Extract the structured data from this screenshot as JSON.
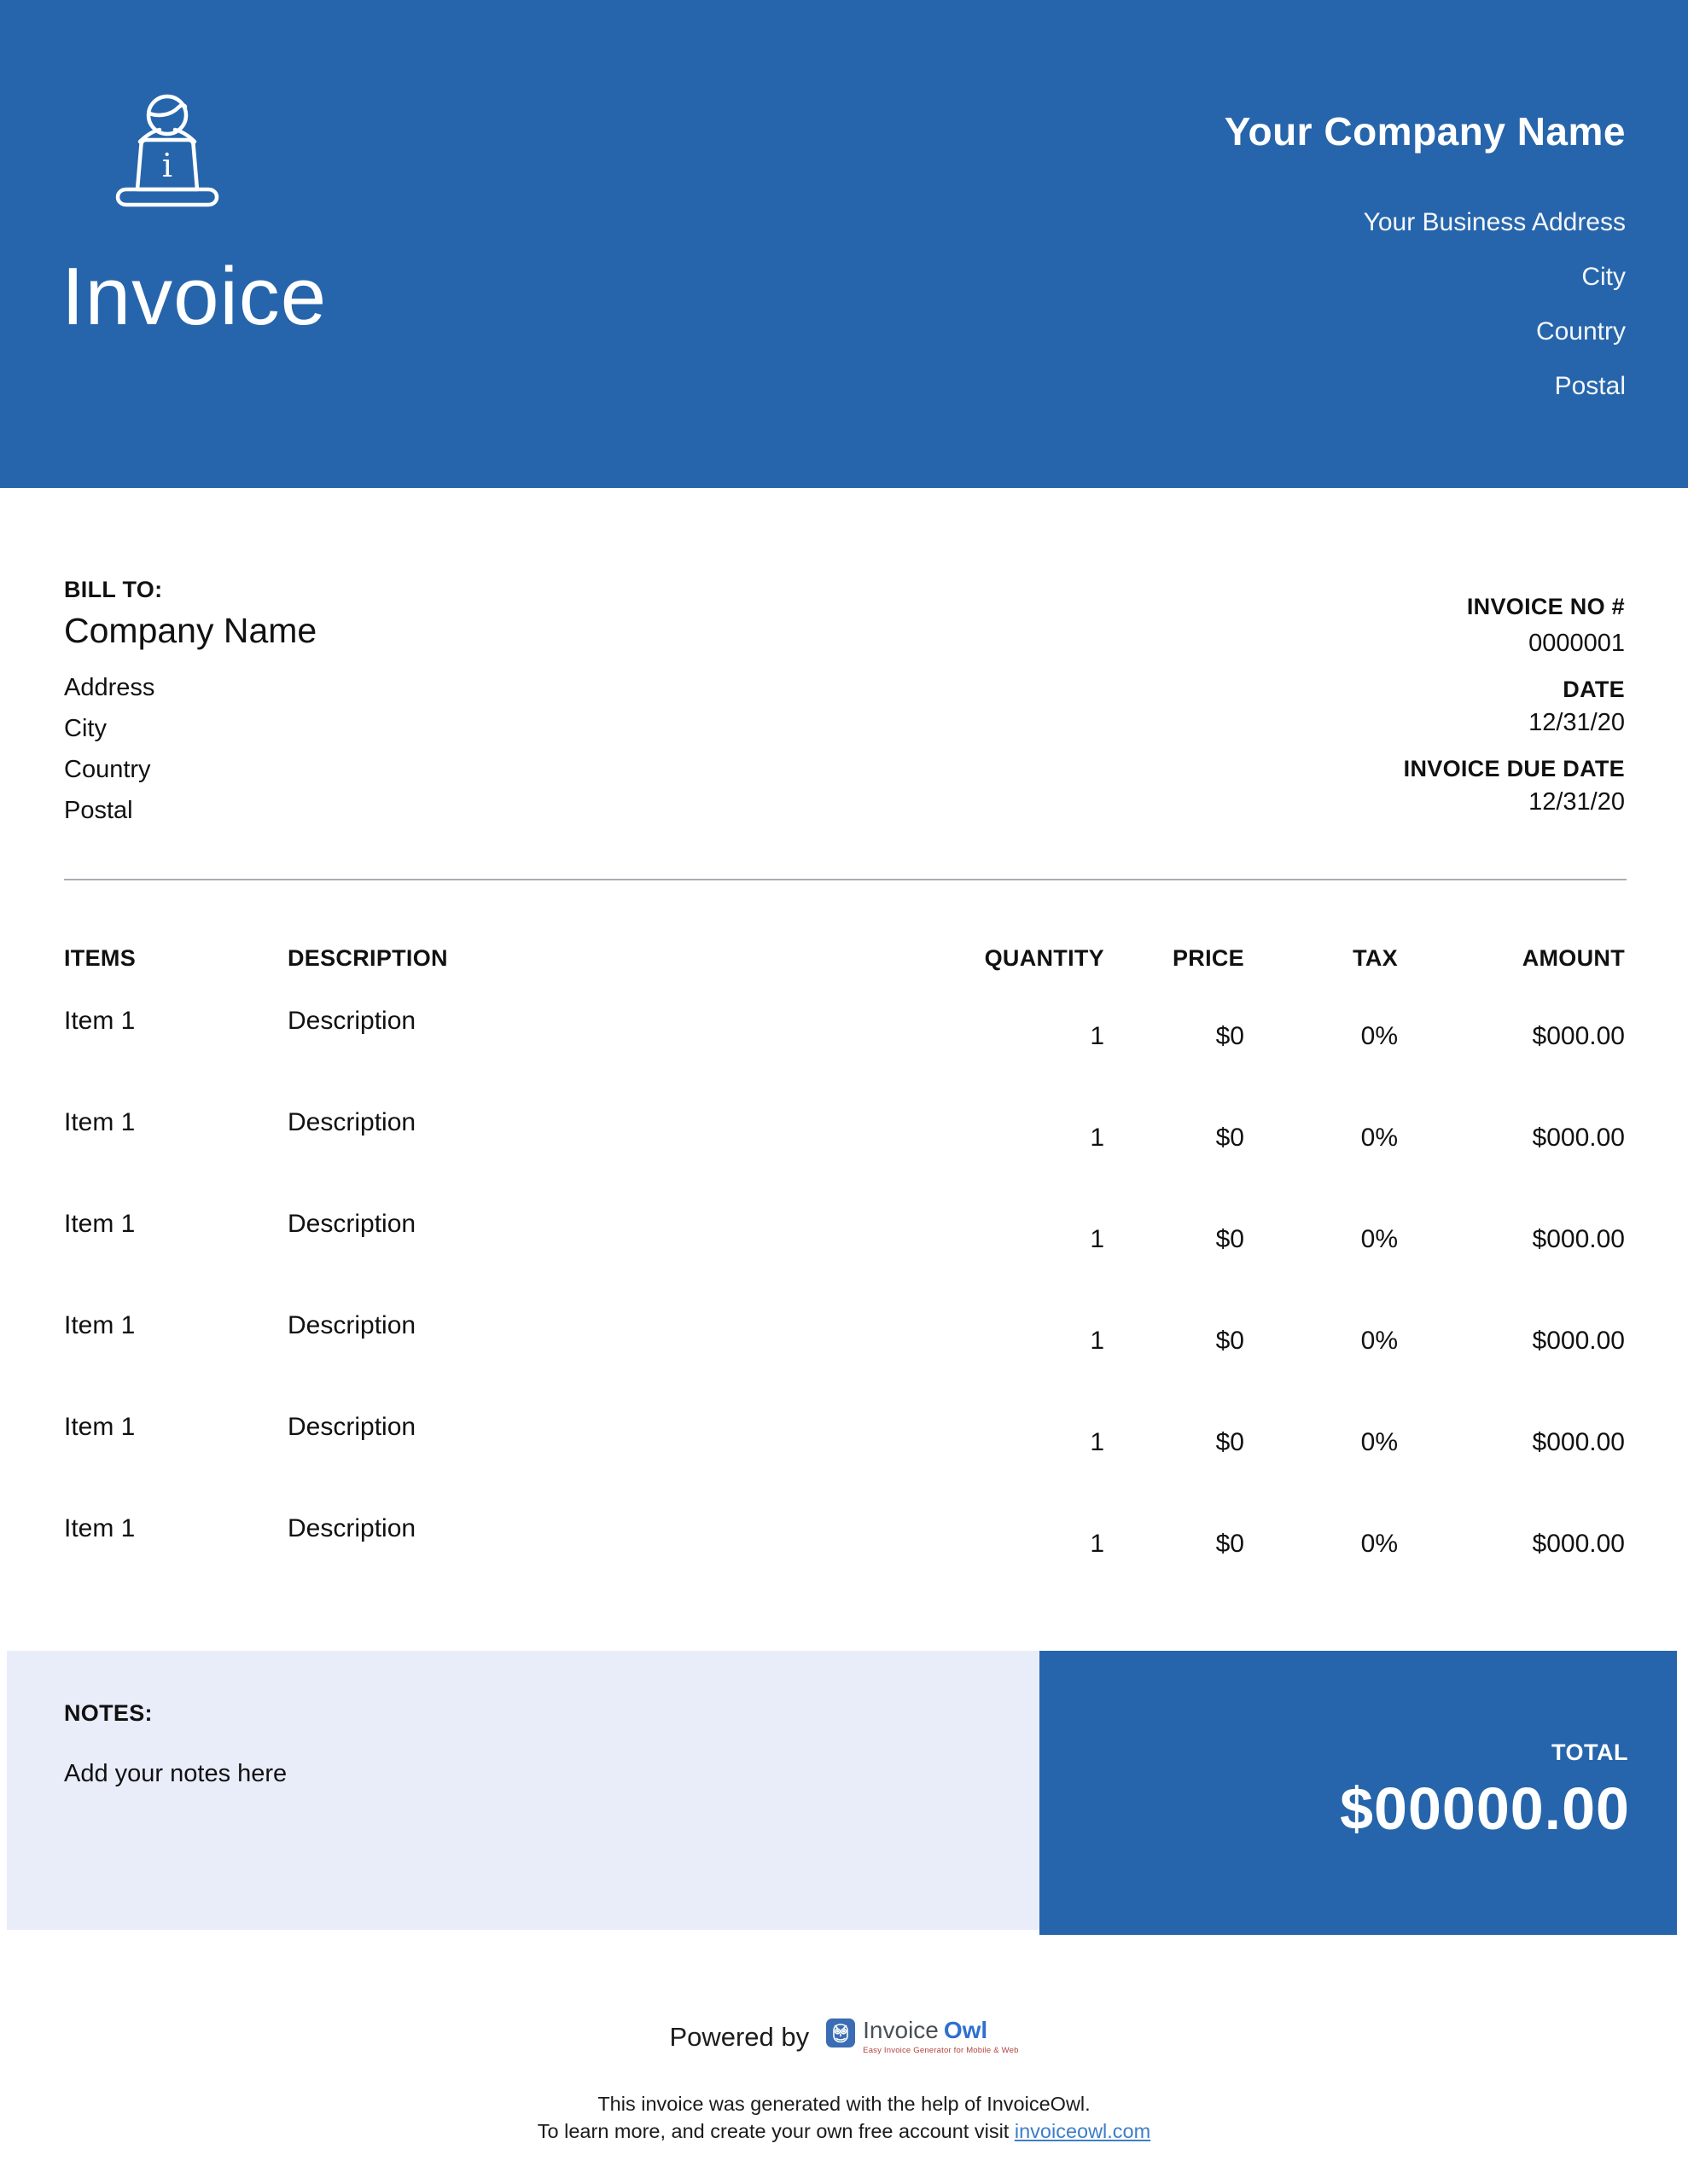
{
  "colors": {
    "primary_blue": "#2665AB",
    "notes_background": "#E9EDFA",
    "link_blue": "#3D7DC8",
    "logo_badge_blue": "#3A6DB3",
    "logo_owl_blue": "#2F6FD0",
    "logo_tagline_red": "#B3443E",
    "divider_gray": "#AAADB3"
  },
  "header": {
    "title": "Invoice",
    "company_name": "Your Company Name",
    "address_lines": [
      "Your Business Address",
      "City",
      "Country",
      "Postal"
    ],
    "icon": "person-at-laptop-icon"
  },
  "bill_to": {
    "label": "BILL TO:",
    "company": "Company Name",
    "lines": [
      "Address",
      "City",
      "Country",
      "Postal"
    ]
  },
  "invoice_meta": {
    "invoice_no_label": "INVOICE NO #",
    "invoice_no": "0000001",
    "date_label": "DATE",
    "date": "12/31/20",
    "due_date_label": "INVOICE DUE DATE",
    "due_date": "12/31/20"
  },
  "table": {
    "columns": [
      "ITEMS",
      "DESCRIPTION",
      "QUANTITY",
      "PRICE",
      "TAX",
      "AMOUNT"
    ],
    "rows": [
      {
        "item": "Item 1",
        "description": "Description",
        "quantity": "1",
        "price": "$0",
        "tax": "0%",
        "amount": "$000.00"
      },
      {
        "item": "Item 1",
        "description": "Description",
        "quantity": "1",
        "price": "$0",
        "tax": "0%",
        "amount": "$000.00"
      },
      {
        "item": "Item 1",
        "description": "Description",
        "quantity": "1",
        "price": "$0",
        "tax": "0%",
        "amount": "$000.00"
      },
      {
        "item": "Item 1",
        "description": "Description",
        "quantity": "1",
        "price": "$0",
        "tax": "0%",
        "amount": "$000.00"
      },
      {
        "item": "Item 1",
        "description": "Description",
        "quantity": "1",
        "price": "$0",
        "tax": "0%",
        "amount": "$000.00"
      },
      {
        "item": "Item 1",
        "description": "Description",
        "quantity": "1",
        "price": "$0",
        "tax": "0%",
        "amount": "$000.00"
      }
    ]
  },
  "notes": {
    "label": "NOTES:",
    "text": "Add your notes here"
  },
  "total": {
    "label": "TOTAL",
    "amount": "$00000.00"
  },
  "footer": {
    "powered_by": "Powered by",
    "brand": {
      "icon": "owl-icon",
      "name_part1": "Invoice",
      "name_part2": "Owl",
      "tagline": "Easy Invoice Generator for Mobile & Web"
    },
    "line1": "This invoice was generated with the help of InvoiceOwl.",
    "line2_prefix": "To learn more, and create your own free account visit ",
    "link_text": "invoiceowl.com"
  }
}
